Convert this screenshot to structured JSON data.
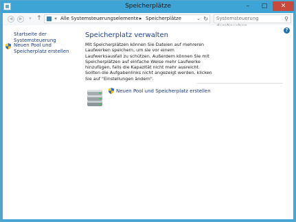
{
  "window": {
    "title": "Speicherplätze",
    "controls": {
      "minimize": "–",
      "maximize": "□",
      "close": "✕"
    }
  },
  "navigation": {
    "breadcrumb": [
      "«",
      "Alle Systemsteuerungselemente",
      "Speicherplätze"
    ],
    "separator": "▸",
    "search_placeholder": "Systemsteuerung durchsuchen",
    "icons": [
      "back-icon",
      "forward-icon",
      "recent-pages-icon",
      "up-icon",
      "control-panel-icon",
      "refresh-icon",
      "search-icon"
    ]
  },
  "sidebar": {
    "items": [
      {
        "label": "Startseite der Systemsteuerung",
        "icon": null
      },
      {
        "label": "Neuen Pool und Speicherplatz erstellen",
        "icon": "uac-shield-icon"
      }
    ]
  },
  "main": {
    "heading": "Speicherplatz verwalten",
    "description": "Mit Speicherplätzen können Sie Dateien auf mehreren Laufwerken speichern, um sie vor einem Laufwerksausfall zu schützen. Außerdem können Sie mit Speicherplätzen auf einfache Weise mehr Laufwerke hinzufügen, falls die Kapazität nicht mehr ausreicht. Sollten die Aufgabenlinks nicht angezeigt werden, klicken Sie auf \"Einstellungen ändern\".",
    "task_link": "Neuen Pool und Speicherplatz erstellen",
    "help": "?"
  },
  "colors": {
    "titlebar": "#3ea3d5",
    "link": "#1b3a86",
    "heading": "#1e3f8a",
    "close_button": "#c9483d"
  }
}
